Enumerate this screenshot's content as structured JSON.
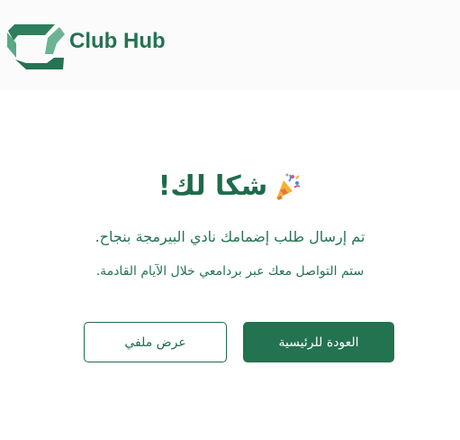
{
  "app": {
    "brand_name": "Club Hub",
    "logo_icon": "club-hub-logo-icon",
    "accent_color": "#247352"
  },
  "confirmation": {
    "title": "شكا لك!",
    "title_icon": "party-popper-icon",
    "message_primary": "تم إرسال طلب إضمامك نادي البيرمجة بنجاح.",
    "message_secondary": "ستم التواصل معك عبر بردامعي خلال الآيام القادمة."
  },
  "actions": {
    "primary_label": "العودة للرئيسية",
    "secondary_label": "عرض ملفي"
  }
}
